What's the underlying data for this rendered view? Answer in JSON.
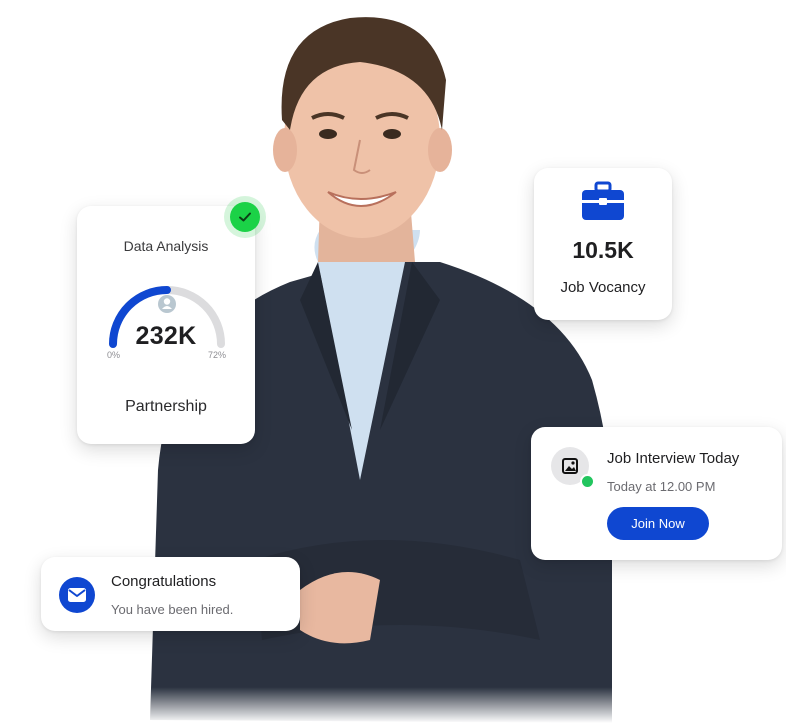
{
  "colors": {
    "accent": "#0f47d1",
    "success": "#1bd247",
    "gauge_track": "#dcdcde"
  },
  "analysis_card": {
    "title": "Data Analysis",
    "value": "232K",
    "min_label": "0%",
    "max_label": "72%",
    "gauge_fill_fraction": 0.5,
    "subtitle": "Partnership",
    "icons": [
      "user-icon",
      "check-icon"
    ]
  },
  "vacancy_card": {
    "value": "10.5K",
    "label": "Job Vocancy",
    "icon": "briefcase-icon"
  },
  "interview_card": {
    "title": "Job Interview Today",
    "time": "Today at 12.00 PM",
    "button_label": "Join Now",
    "icon": "image-icon",
    "status": "online"
  },
  "congrats_card": {
    "title": "Congratulations",
    "message": "You have been hired.",
    "icon": "mail-icon"
  }
}
